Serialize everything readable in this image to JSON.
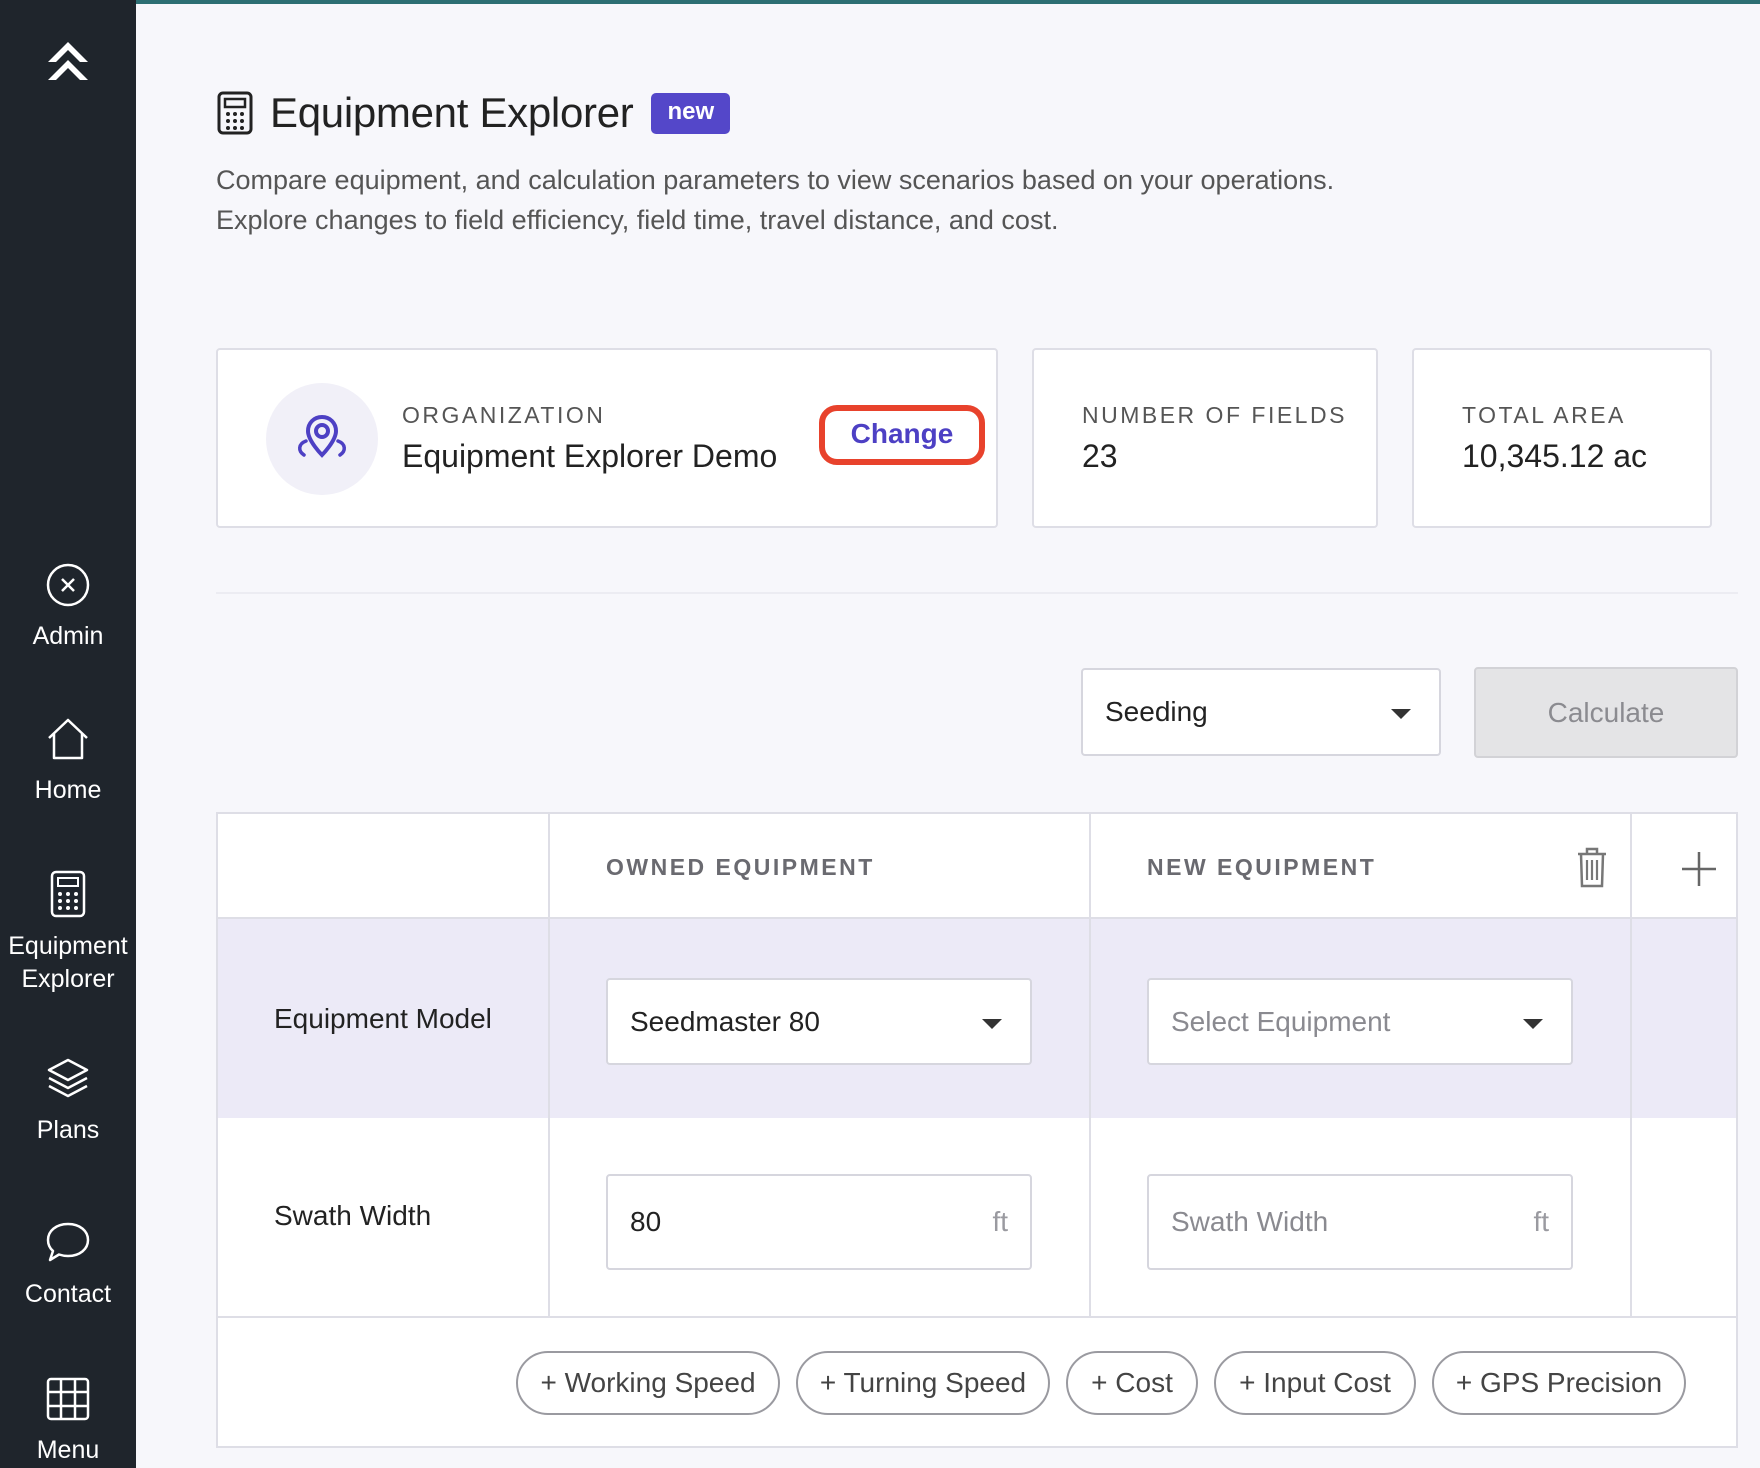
{
  "sidebar": {
    "items": [
      {
        "label": "Admin",
        "icon": "close-circle-icon"
      },
      {
        "label": "Home",
        "icon": "home-icon"
      },
      {
        "label_line1": "Equipment",
        "label_line2": "Explorer",
        "icon": "calculator-icon"
      },
      {
        "label": "Plans",
        "icon": "layers-icon"
      },
      {
        "label": "Contact",
        "icon": "chat-bubble-icon"
      },
      {
        "label": "Menu",
        "icon": "grid-icon"
      }
    ]
  },
  "header": {
    "title": "Equipment Explorer",
    "badge": "new",
    "description_line1": "Compare equipment, and calculation parameters to view scenarios based on your operations.",
    "description_line2": "Explore changes to field efficiency, field time, travel distance, and cost."
  },
  "cards": {
    "organization": {
      "label": "ORGANIZATION",
      "value": "Equipment Explorer Demo",
      "action": "Change"
    },
    "fields": {
      "label": "NUMBER OF FIELDS",
      "value": "23"
    },
    "area": {
      "label": "TOTAL AREA",
      "value": "10,345.12 ac"
    }
  },
  "controls": {
    "operation": "Seeding",
    "calculate": "Calculate"
  },
  "table": {
    "headers": {
      "owned": "OWNED EQUIPMENT",
      "new": "NEW EQUIPMENT"
    },
    "rows": {
      "model": {
        "label": "Equipment Model",
        "owned": "Seedmaster 80",
        "new_placeholder": "Select Equipment"
      },
      "swath": {
        "label": "Swath Width",
        "owned": "80",
        "new_placeholder": "Swath Width",
        "unit": "ft"
      }
    },
    "add_buttons": [
      "+ Working Speed",
      "+ Turning Speed",
      "+ Cost",
      "+ Input Cost",
      "+ GPS Precision"
    ]
  },
  "colors": {
    "accent": "#5447c9",
    "sidebar": "#1f252c",
    "highlight_row": "#eceaf7",
    "change_outline": "#e8422c"
  }
}
